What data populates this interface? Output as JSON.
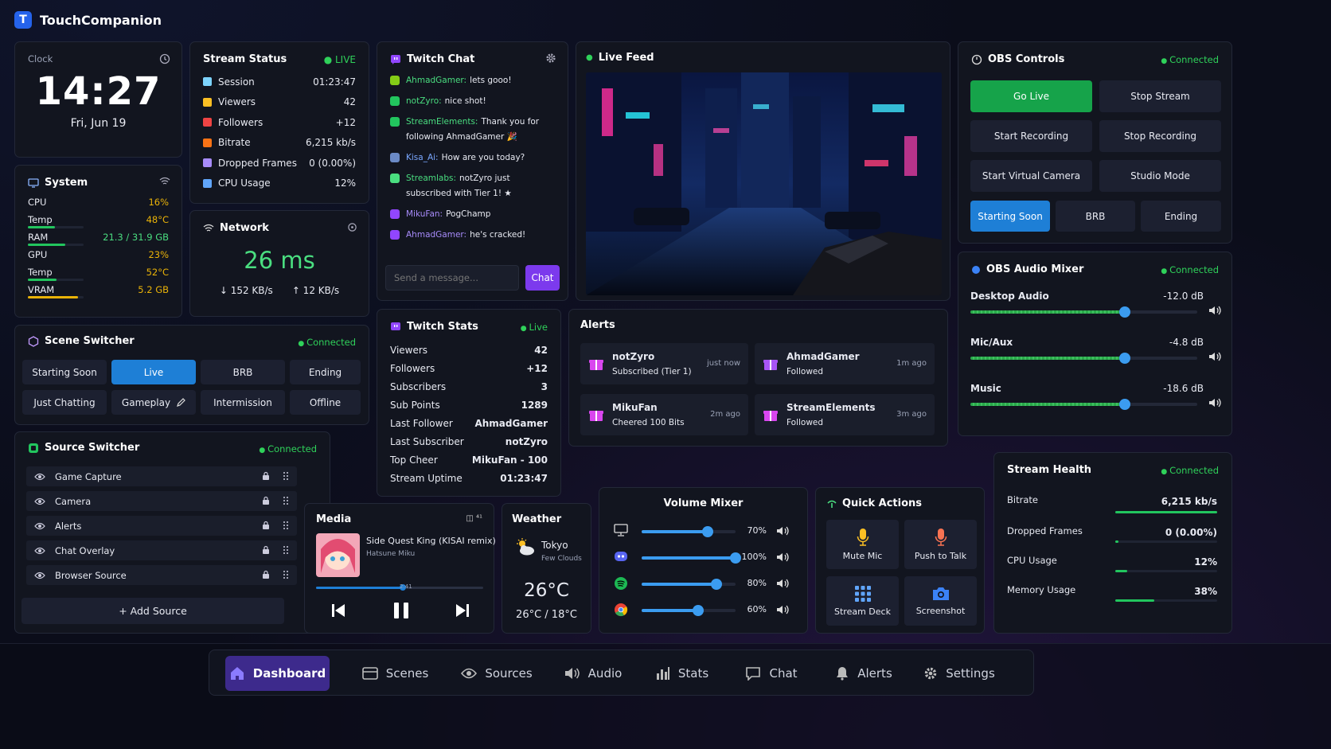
{
  "app": {
    "title": "TouchCompanion",
    "logo_letter": "T"
  },
  "clock": {
    "label": "Clock",
    "time": "14:27",
    "date": "Fri, Jun 19"
  },
  "system": {
    "title": "System",
    "rows": [
      {
        "label": "CPU",
        "value": "16%",
        "bar": null
      },
      {
        "label": "Temp",
        "value": "48°C",
        "bar": 0.48
      },
      {
        "label": "RAM",
        "value": "21.3 / 31.9 GB",
        "bar": 0.67
      },
      {
        "label": "GPU",
        "value": "23%",
        "bar": null
      },
      {
        "label": "Temp",
        "value": "52°C",
        "bar": 0.52
      },
      {
        "label": "VRAM",
        "value": "5.2 GB",
        "bar": 0.9
      }
    ]
  },
  "stream_status": {
    "title": "Stream Status",
    "live": "LIVE",
    "rows": [
      {
        "label": "Session",
        "value": "01:23:47"
      },
      {
        "label": "Viewers",
        "value": "42"
      },
      {
        "label": "Followers",
        "value": "+12"
      },
      {
        "label": "Bitrate",
        "value": "6,215 kb/s"
      },
      {
        "label": "Dropped Frames",
        "value": "0 (0.00%)"
      },
      {
        "label": "CPU Usage",
        "value": "12%"
      }
    ]
  },
  "network": {
    "title": "Network",
    "latency": "26 ms",
    "down": "↓ 152 KB/s",
    "up": "↑ 12 KB/s"
  },
  "twitch_chat": {
    "title": "Twitch Chat",
    "messages": [
      {
        "user": "AhmadGamer:",
        "text": "lets gooo!"
      },
      {
        "user": "notZyro:",
        "text": "nice shot!"
      },
      {
        "user": "StreamElements:",
        "text": "Thank you for following AhmadGamer 🎉"
      },
      {
        "user": "Kisa_Ai:",
        "text": "How are you today?"
      },
      {
        "user": "Streamlabs:",
        "text": "notZyro just subscribed with Tier 1! ★"
      },
      {
        "user": "MikuFan:",
        "text": "PogChamp"
      },
      {
        "user": "AhmadGamer:",
        "text": "he's cracked!"
      }
    ],
    "placeholder": "Send a message...",
    "send_label": "Chat"
  },
  "live_feed": {
    "title": "Live Feed"
  },
  "obs_controls": {
    "title": "OBS Controls",
    "status": "Connected",
    "go_live": "Go Live",
    "stop_stream": "Stop Stream",
    "start_recording": "Start Recording",
    "stop_recording": "Stop Recording",
    "start_virtual_camera": "Start Virtual Camera",
    "studio_mode": "Studio Mode",
    "scene_starting": "Starting Soon",
    "scene_brb": "BRB",
    "scene_ending": "Ending"
  },
  "audio_mixer": {
    "title": "OBS Audio Mixer",
    "status": "Connected",
    "channels": [
      {
        "label": "Desktop Audio",
        "db": "-12.0 dB",
        "level": 0.68
      },
      {
        "label": "Mic/Aux",
        "db": "-4.8 dB",
        "level": 0.68
      },
      {
        "label": "Music",
        "db": "-18.6 dB",
        "level": 0.68
      }
    ]
  },
  "scene_switcher": {
    "title": "Scene Switcher",
    "status": "Connected",
    "scenes": [
      "Starting Soon",
      "Live",
      "BRB",
      "Ending",
      "Just Chatting",
      "Gameplay",
      "Intermission",
      "Offline"
    ]
  },
  "twitch_stats": {
    "title": "Twitch Stats",
    "status": "Live",
    "rows": [
      {
        "label": "Viewers",
        "value": "42"
      },
      {
        "label": "Followers",
        "value": "+12"
      },
      {
        "label": "Subscribers",
        "value": "3"
      },
      {
        "label": "Sub Points",
        "value": "1289"
      },
      {
        "label": "Last Follower",
        "value": "AhmadGamer"
      },
      {
        "label": "Last Subscriber",
        "value": "notZyro"
      },
      {
        "label": "Top Cheer",
        "value": "MikuFan - 100"
      },
      {
        "label": "Stream Uptime",
        "value": "01:23:47"
      }
    ]
  },
  "alerts": {
    "title": "Alerts",
    "items": [
      {
        "name": "notZyro",
        "desc": "Subscribed (Tier 1)",
        "time": "just now"
      },
      {
        "name": "AhmadGamer",
        "desc": "Followed",
        "time": "1m ago"
      },
      {
        "name": "MikuFan",
        "desc": "Cheered 100 Bits",
        "time": "2m ago"
      },
      {
        "name": "StreamElements",
        "desc": "Followed",
        "time": "3m ago"
      }
    ]
  },
  "source_switcher": {
    "title": "Source Switcher",
    "status": "Connected",
    "sources": [
      "Game Capture",
      "Camera",
      "Alerts",
      "Chat Overlay",
      "Browser Source"
    ],
    "add_label": "+ Add Source"
  },
  "media": {
    "title": "Media",
    "track": "Side Quest King (KISAI remix)",
    "artist": "Hatsune Miku",
    "progress": 0.52,
    "progress_label": "2:41"
  },
  "weather": {
    "title": "Weather",
    "city": "Tokyo",
    "condition": "Few Clouds",
    "temp": "26°C",
    "range": "26°C / 18°C"
  },
  "volume_mixer": {
    "title": "Volume Mixer",
    "channels": [
      {
        "app": "desktop",
        "value": "70%",
        "level": 0.7
      },
      {
        "app": "discord",
        "value": "100%",
        "level": 1.0
      },
      {
        "app": "spotify",
        "value": "80%",
        "level": 0.8
      },
      {
        "app": "chrome",
        "value": "60%",
        "level": 0.6
      }
    ]
  },
  "quick_actions": {
    "title": "Quick Actions",
    "mute": "Mute Mic",
    "ptt": "Push to Talk",
    "deck": "Stream Deck",
    "shot": "Screenshot"
  },
  "stream_health": {
    "title": "Stream Health",
    "status": "Connected",
    "rows": [
      {
        "label": "Bitrate",
        "value": "6,215 kb/s",
        "level": 1.0
      },
      {
        "label": "Dropped Frames",
        "value": "0 (0.00%)",
        "level": 0.02
      },
      {
        "label": "CPU Usage",
        "value": "12%",
        "level": 0.12
      },
      {
        "label": "Memory Usage",
        "value": "38%",
        "level": 0.38
      }
    ]
  },
  "nav": {
    "items": [
      "Dashboard",
      "Scenes",
      "Sources",
      "Audio",
      "Stats",
      "Chat",
      "Alerts",
      "Settings"
    ]
  },
  "colors": {
    "accent": "#1e7fd6",
    "live_green": "#16a34a",
    "twitch": "#7c3aed",
    "ok": "#2fd15a"
  }
}
